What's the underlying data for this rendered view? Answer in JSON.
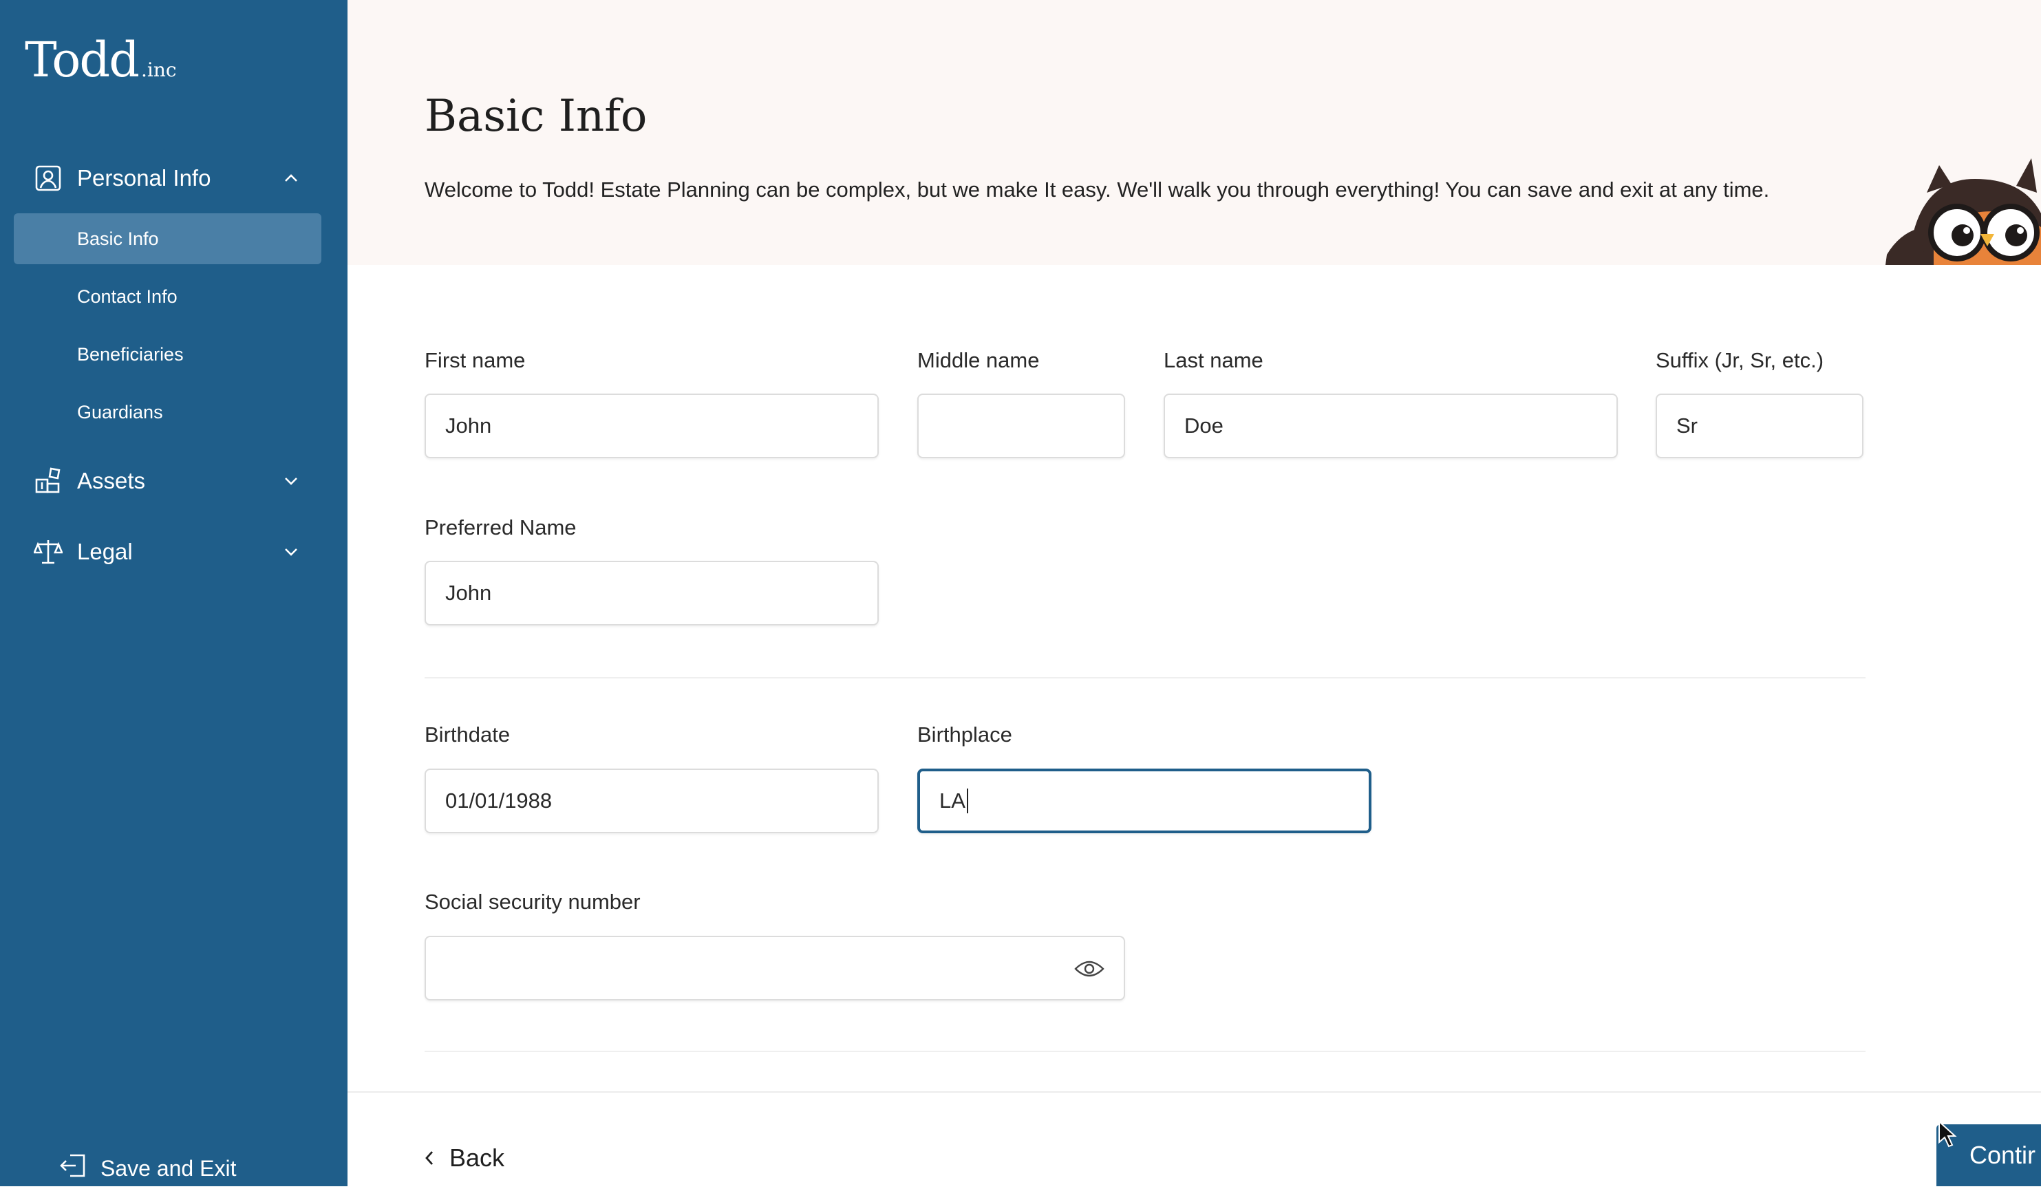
{
  "brand": {
    "name": "Todd",
    "suffix": ".inc"
  },
  "sidebar": {
    "sections": [
      {
        "label": "Personal Info",
        "icon": "user-icon",
        "expanded": true,
        "items": [
          "Basic Info",
          "Contact Info",
          "Beneficiaries",
          "Guardians"
        ],
        "active_item": "Basic Info"
      },
      {
        "label": "Assets",
        "icon": "blocks-icon",
        "expanded": false
      },
      {
        "label": "Legal",
        "icon": "scale-icon",
        "expanded": false
      }
    ],
    "save_exit": "Save and Exit"
  },
  "header": {
    "title": "Basic Info",
    "intro": "Welcome to Todd! Estate Planning can be complex, but we make It easy. We'll walk you through everything! You can save and exit at any time."
  },
  "form": {
    "first_name": {
      "label": "First name",
      "value": "John"
    },
    "middle_name": {
      "label": "Middle name",
      "value": ""
    },
    "last_name": {
      "label": "Last name",
      "value": "Doe"
    },
    "suffix": {
      "label": "Suffix (Jr, Sr, etc.)",
      "value": "Sr"
    },
    "preferred_name": {
      "label": "Preferred Name",
      "value": "John"
    },
    "birthdate": {
      "label": "Birthdate",
      "value": "01/01/1988"
    },
    "birthplace": {
      "label": "Birthplace",
      "value": "LA"
    },
    "ssn": {
      "label": "Social security number",
      "value": ""
    }
  },
  "footer": {
    "back": "Back",
    "continue": "Contir"
  },
  "colors": {
    "sidebar": "#1f5e8a",
    "active_item": "#4a7fa6",
    "header_bg": "#fcf7f5",
    "focus": "#1f5e8a"
  }
}
